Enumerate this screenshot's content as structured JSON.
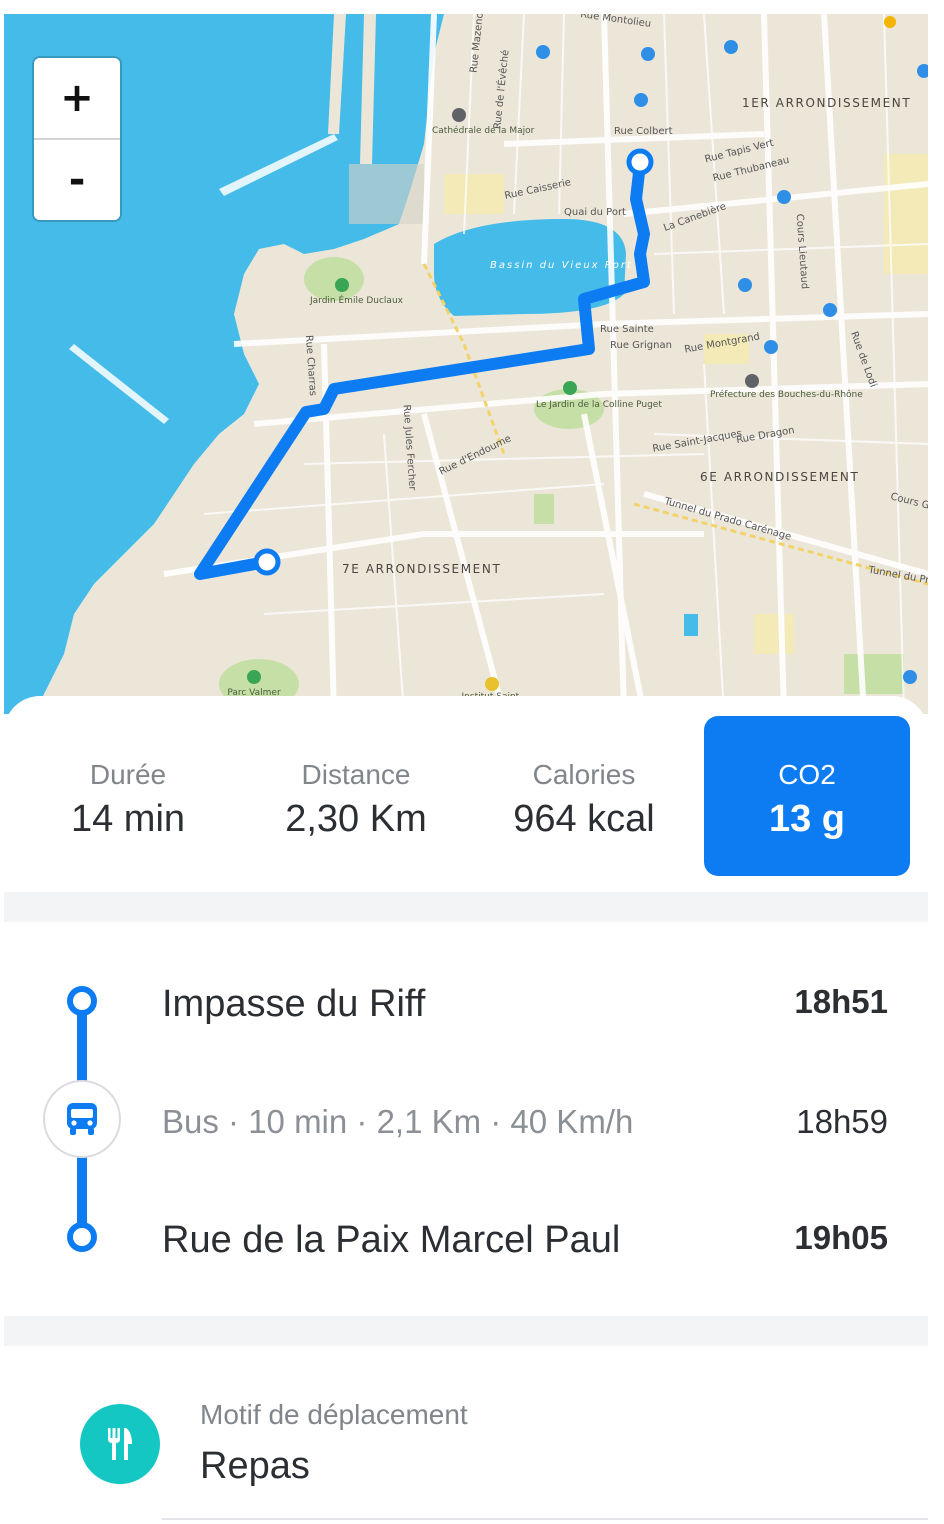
{
  "map": {
    "zoom_in_label": "+",
    "zoom_out_label": "-",
    "districts": [
      "1ER ARRONDISSEMENT",
      "6E ARRONDISSEMENT",
      "7E ARRONDISSEMENT"
    ],
    "water_label": "Bassin du Vieux Port",
    "pois": [
      "Cathédrale de la Major",
      "Jardin Émile Duclaux",
      "Le Jardin de la Colline Puget",
      "Préfecture des Bouches-du-Rhône",
      "Parc Valmer",
      "Institut Saint-"
    ],
    "streets": [
      "Rue Colbert",
      "Rue Caisserie",
      "Quai du Port",
      "La Canebière",
      "Rue Tapis Vert",
      "Rue Thubaneau",
      "Cours Lieutaud",
      "Rue Sainte",
      "Rue Grignan",
      "Rue Montgrand",
      "Rue Saint-Jacques",
      "Rue Dragon",
      "Rue d'Endoume",
      "Rue Charras",
      "Rue Jules Fercher",
      "Tunnel du Prado Carénage",
      "Rue de Lodi",
      "Rue Montolieu",
      "Rue de l'Évêché",
      "Rue Mazenod",
      "Cours G",
      "Tunnel du Pr"
    ],
    "colors": {
      "sea": "#44bbe8",
      "land": "#ece6d9",
      "route": "#0d7cf2",
      "park": "#c6dfa6"
    }
  },
  "stats": [
    {
      "label": "Durée",
      "value": "14 min",
      "active": false
    },
    {
      "label": "Distance",
      "value": "2,30 Km",
      "active": false
    },
    {
      "label": "Calories",
      "value": "964 kcal",
      "active": false
    },
    {
      "label": "CO2",
      "value": "13 g",
      "active": true
    }
  ],
  "itinerary": {
    "origin": {
      "name": "Impasse du Riff",
      "time": "18h51"
    },
    "leg": {
      "description": "Bus · 10 min · 2,1 Km · 40 Km/h",
      "time": "18h59",
      "mode_icon": "bus-icon"
    },
    "destination": {
      "name": "Rue de la Paix Marcel Paul",
      "time": "19h05"
    }
  },
  "motif": {
    "label": "Motif de déplacement",
    "value": "Repas",
    "icon": "fork-knife-icon",
    "icon_color": "#14c7c3"
  },
  "accent_color": "#0d7cf2"
}
